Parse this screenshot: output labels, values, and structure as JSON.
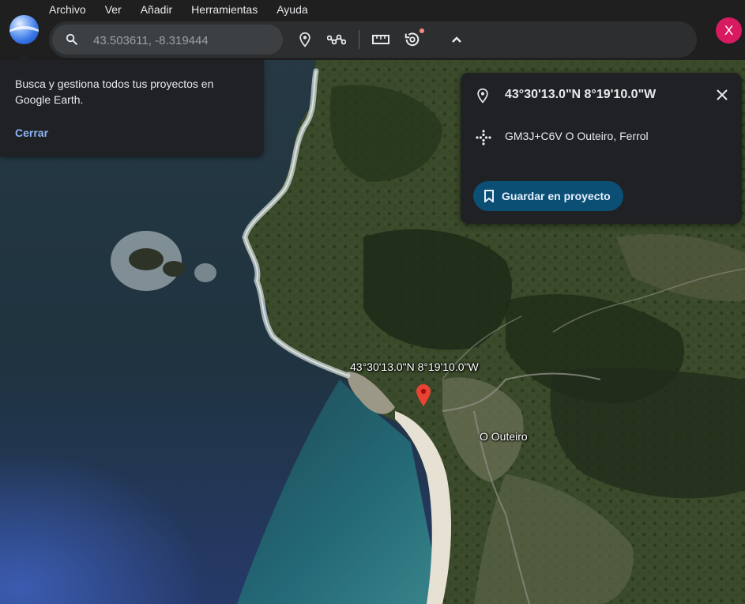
{
  "menu": [
    "Archivo",
    "Ver",
    "Añadir",
    "Herramientas",
    "Ayuda"
  ],
  "search": {
    "placeholder": "43.503611, -8.319444"
  },
  "toolbar": {
    "tools": [
      "place-pin-icon",
      "path-icon",
      "ruler-icon",
      "history-icon",
      "chevron-up-icon"
    ]
  },
  "user": {
    "avatar_letter": "X",
    "avatar_color": "#d81b60"
  },
  "tip": {
    "text": "Busca y gestiona todos tus proyectos en Google Earth.",
    "close_label": "Cerrar"
  },
  "place": {
    "coordinates": "43°30'13.0\"N 8°19'10.0\"W",
    "plus_code": "GM3J+C6V O Outeiro, Ferrol",
    "save_label": "Guardar en proyecto"
  },
  "map_labels": {
    "coordinates": "43°30'13.0\"N 8°19'10.0\"W",
    "town": "O Outeiro"
  },
  "colors": {
    "accent": "#8ab4f8",
    "save_button": "#0b4f75",
    "pin": "#ea4335"
  }
}
